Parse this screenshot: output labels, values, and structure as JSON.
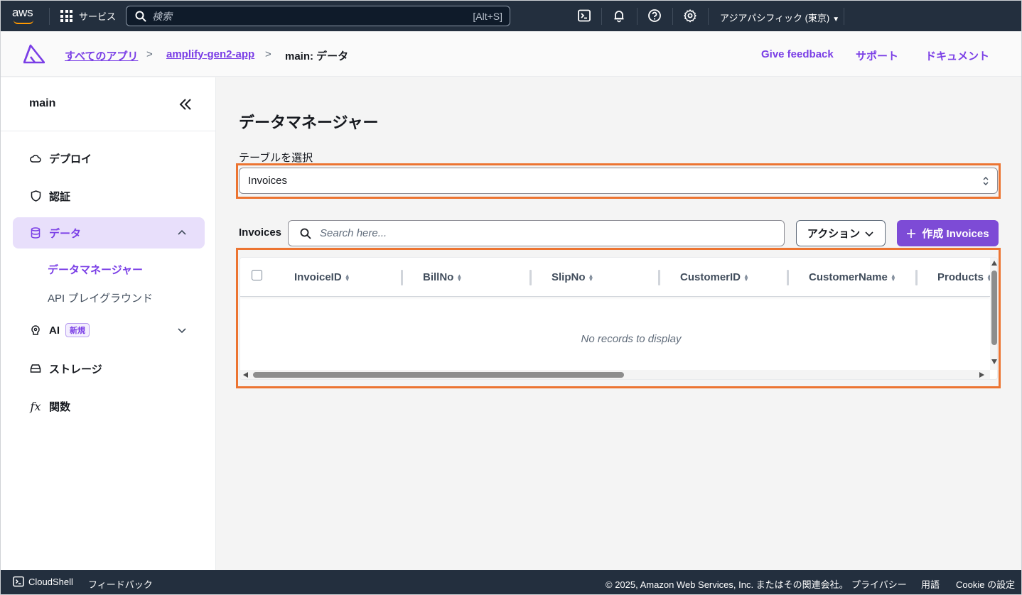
{
  "topnav": {
    "logo_text": "aws",
    "services_label": "サービス",
    "search_placeholder": "検索",
    "search_shortcut": "[Alt+S]",
    "region_label": "アジアパシフィック (東京)",
    "icons": [
      "cloudshell-icon",
      "bell-icon",
      "help-icon",
      "settings-icon"
    ]
  },
  "breadcrumb": {
    "items": [
      "すべてのアプリ",
      "amplify-gen2-app",
      "main: データ"
    ],
    "links": [
      "Give feedback",
      "サポート",
      "ドキュメント"
    ]
  },
  "sidebar": {
    "title": "main",
    "items": [
      {
        "label": "デプロイ",
        "icon": "cloud-icon"
      },
      {
        "label": "認証",
        "icon": "shield-icon"
      },
      {
        "label": "データ",
        "icon": "database-icon",
        "active": true
      },
      {
        "label": "AI",
        "icon": "brain-icon",
        "badge": "新規"
      },
      {
        "label": "ストレージ",
        "icon": "storage-icon"
      },
      {
        "label": "関数",
        "icon": "function-icon"
      }
    ],
    "subitems": [
      "データマネージャー",
      "API プレイグラウンド"
    ]
  },
  "main": {
    "title": "データマネージャー",
    "select_label": "テーブルを選択",
    "select_value": "Invoices",
    "table_label": "Invoices",
    "search_placeholder": "Search here...",
    "action_label": "アクション",
    "create_label": "作成 Invoices",
    "columns": [
      "InvoiceID",
      "BillNo",
      "SlipNo",
      "CustomerID",
      "CustomerName",
      "Products"
    ],
    "empty_message": "No records to display"
  },
  "footer": {
    "cloudshell": "CloudShell",
    "feedback": "フィードバック",
    "copyright": "© 2025, Amazon Web Services, Inc. またはその関連会社。",
    "privacy": "プライバシー",
    "terms": "用語",
    "cookie": "Cookie の設定"
  },
  "colors": {
    "accent": "#7a3ee6",
    "highlight": "#ec7431",
    "nav_bg": "#232f3e"
  }
}
